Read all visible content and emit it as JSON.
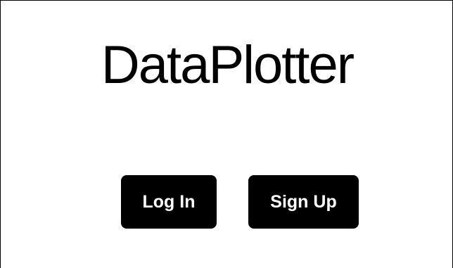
{
  "app": {
    "title": "DataPlotter"
  },
  "actions": {
    "login_label": "Log In",
    "signup_label": "Sign Up"
  },
  "colors": {
    "background": "#ffffff",
    "button_bg": "#000000",
    "button_text": "#ffffff",
    "title_text": "#000000"
  }
}
